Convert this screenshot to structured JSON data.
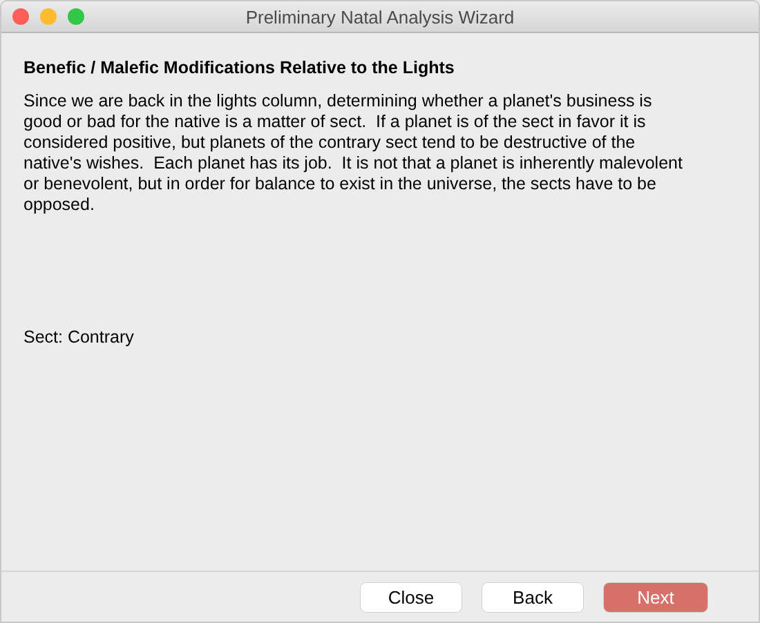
{
  "window": {
    "title": "Preliminary Natal Analysis Wizard"
  },
  "heading": "Benefic / Malefic Modifications Relative to the Lights",
  "paragraph": "Since we are back in the lights column, determining whether a planet's business is\ngood or bad for the native is a matter of sect.  If a planet is of the sect in favor it is\nconsidered positive, but planets of the contrary sect tend to be destructive of the\nnative's wishes.  Each planet has its job.  It is not that a planet is inherently malevolent\nor benevolent, but in order for balance to exist in the universe, the sects have to be\nopposed.",
  "sect": "Sect: Contrary",
  "buttons": [
    {
      "label": "Close",
      "default": false
    },
    {
      "label": "Back",
      "default": false
    },
    {
      "label": "Next",
      "default": true
    }
  ]
}
